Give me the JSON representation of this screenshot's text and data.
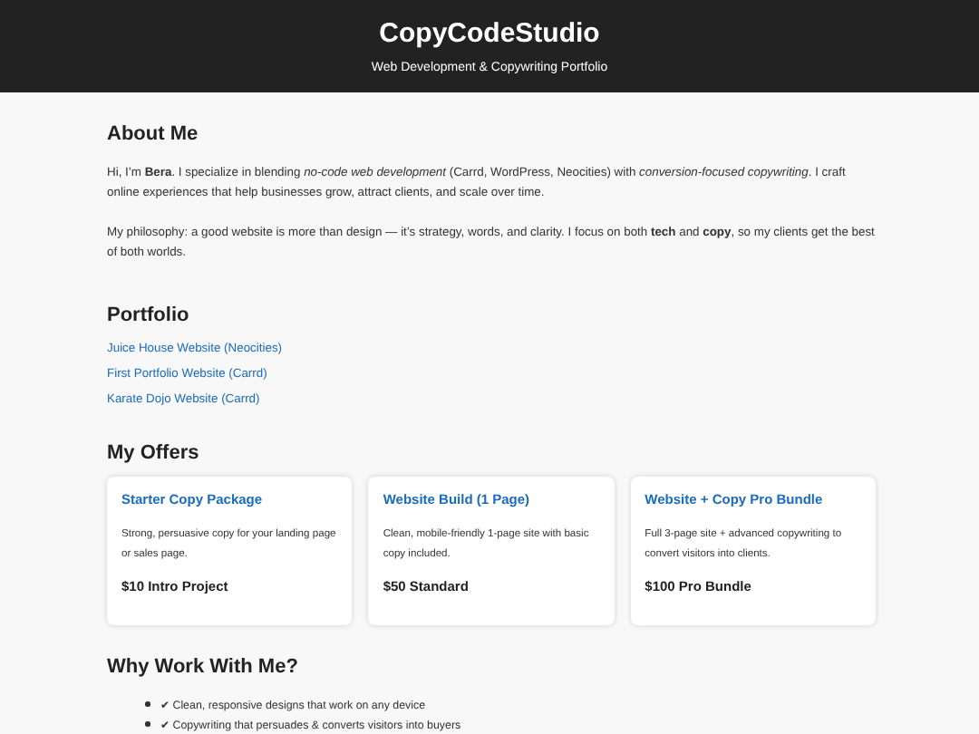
{
  "header": {
    "title": "CopyCodeStudio",
    "subtitle": "Web Development & Copywriting Portfolio"
  },
  "about": {
    "heading": "About Me",
    "paragraphs": [
      "Hi, I’m **Bera**. I specialize in blending *no-code web development* (Carrd, WordPress, Neocities) with *conversion-focused copywriting*. I craft online experiences that help businesses grow, attract clients, and scale over time.",
      "My philosophy: a good website is more than design — it’s strategy, words, and clarity. I focus on both **tech** and **copy**, so my clients get the best of both worlds."
    ]
  },
  "portfolio": {
    "heading": "Portfolio",
    "links": [
      "Juice House Website (Neocities)",
      "First Portfolio Website (Carrd)",
      "Karate Dojo Website (Carrd)"
    ]
  },
  "offers": {
    "heading": "My Offers",
    "cards": [
      {
        "title": "Starter Copy Package",
        "description": "Strong, persuasive copy for your landing page or sales page.",
        "price": "$10 Intro Project"
      },
      {
        "title": "Website Build (1 Page)",
        "description": "Clean, mobile-friendly 1-page site with basic copy included.",
        "price": "$50 Standard"
      },
      {
        "title": "Website + Copy Pro Bundle",
        "description": "Full 3-page site + advanced copywriting to convert visitors into clients.",
        "price": "$100 Pro Bundle"
      }
    ]
  },
  "why": {
    "heading": "Why Work With Me?",
    "items": [
      "✔ Clean, responsive designs that work on any device",
      "✔ Copywriting that persuades & converts visitors into buyers"
    ]
  }
}
